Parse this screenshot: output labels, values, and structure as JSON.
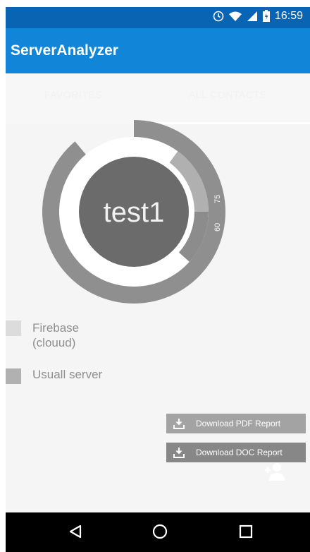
{
  "status_bar": {
    "time": "16:59"
  },
  "app_bar": {
    "title": "ServerAnalyzer"
  },
  "tabs": [
    {
      "label": "FAVORITES"
    },
    {
      "label": "ALL CONTACTS"
    }
  ],
  "chart_data": {
    "type": "pie",
    "center_label": "test1",
    "series": [
      {
        "name": "Firebase (clouud)",
        "value": 75
      },
      {
        "name": "Usuall server",
        "value": 60
      }
    ],
    "data_labels": [
      "75",
      "60"
    ]
  },
  "legend": [
    {
      "label_line1": "Firebase",
      "label_line2": "(clouud)",
      "color": "#dcdcdc"
    },
    {
      "label_line1": "Usuall server",
      "color": "#b1b1b1"
    }
  ],
  "buttons": {
    "pdf": "Download PDF Report",
    "doc": "Download DOC Report"
  },
  "icons": {
    "download": "download-icon",
    "add_person": "add-person-icon",
    "back": "back-triangle-icon",
    "home": "home-circle-icon",
    "recents": "recents-square-icon"
  }
}
